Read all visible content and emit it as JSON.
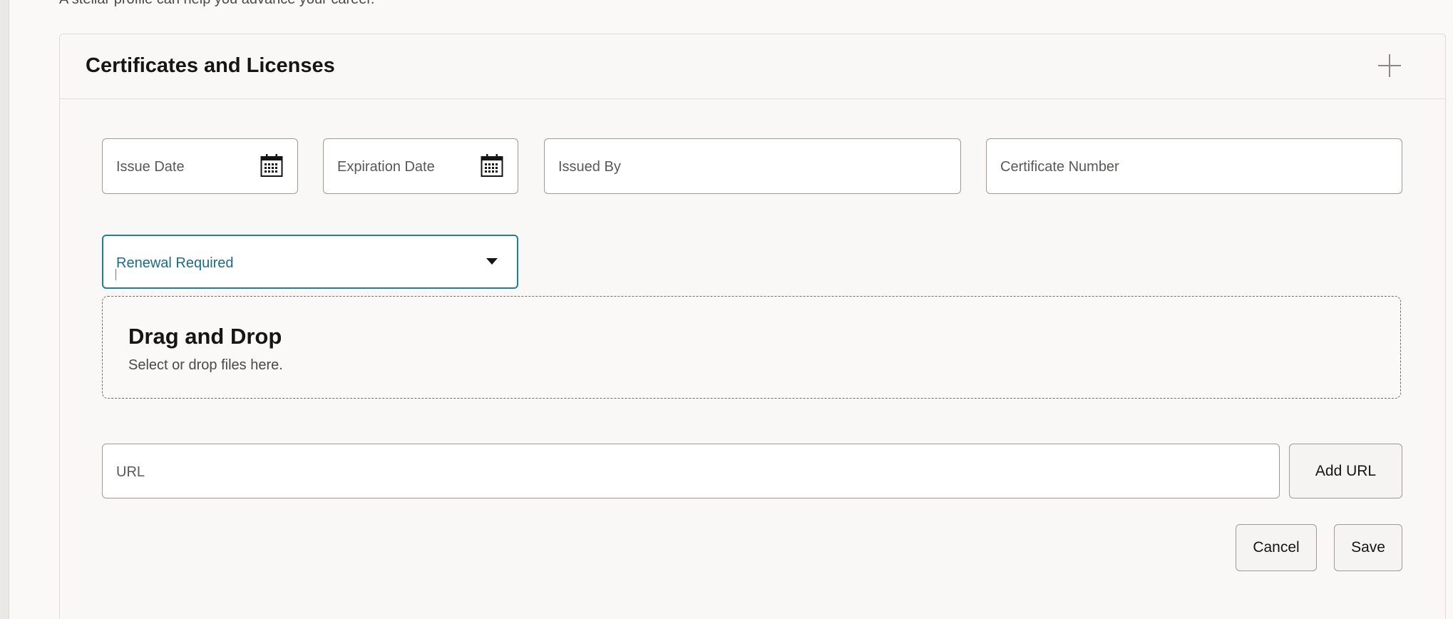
{
  "page": {
    "subtitle": "A stellar profile can help you advance your career."
  },
  "section": {
    "title": "Certificates and Licenses",
    "add_icon": "plus-icon"
  },
  "form": {
    "issue_date": {
      "placeholder": "Issue Date",
      "icon": "calendar-icon"
    },
    "expiration_date": {
      "placeholder": "Expiration Date",
      "icon": "calendar-icon"
    },
    "issued_by": {
      "placeholder": "Issued By"
    },
    "certificate_number": {
      "placeholder": "Certificate Number"
    },
    "renewal_required": {
      "label": "Renewal Required",
      "icon": "chevron-down-icon",
      "focused": true
    },
    "dropzone": {
      "title": "Drag and Drop",
      "subtitle": "Select or drop files here."
    },
    "url": {
      "placeholder": "URL"
    },
    "add_url_label": "Add URL",
    "cancel_label": "Cancel",
    "save_label": "Save"
  },
  "colors": {
    "focus_border": "#227e9e",
    "focus_label": "#1a6b8a",
    "background": "#faf9f8"
  }
}
